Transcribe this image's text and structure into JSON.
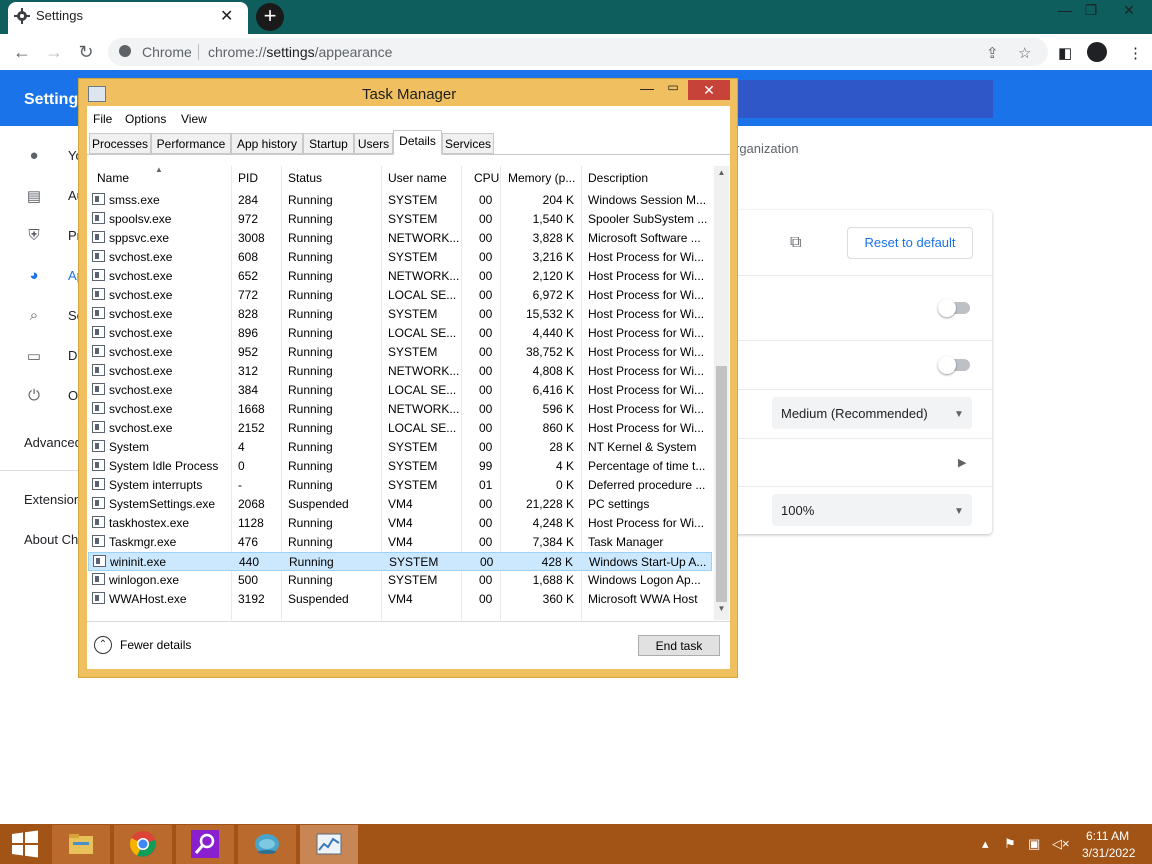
{
  "browser": {
    "tab_title": "Settings",
    "tab_close": "✕",
    "new_tab": "+",
    "window_controls": [
      "—",
      "❐",
      "✕"
    ],
    "omnibox_label": "Chrome",
    "url_scheme": "chrome://",
    "url_host": "settings",
    "url_path": "/appearance",
    "toolbar_icons": [
      "share-icon",
      "star-icon",
      "sidepanel-icon",
      "profile-icon",
      "menu-icon"
    ]
  },
  "settings": {
    "header_title": "Settings",
    "nav_items": [
      {
        "label": "Yo",
        "icon": "person-icon"
      },
      {
        "label": "Au",
        "icon": "autofill-icon"
      },
      {
        "label": "Pr",
        "icon": "shield-icon"
      },
      {
        "label": "Ap",
        "icon": "palette-icon"
      },
      {
        "label": "Se",
        "icon": "search-icon"
      },
      {
        "label": "De",
        "icon": "browser-icon"
      },
      {
        "label": "Or",
        "icon": "power-icon"
      }
    ],
    "advanced": "Advanced",
    "extensions": "Extension",
    "about": "About Ch",
    "org_note": "rganization",
    "reset_button": "Reset to default",
    "font_size_value": "Medium (Recommended)",
    "zoom_value": "100%",
    "accent_color": "#1a73e8"
  },
  "task_manager": {
    "title": "Task Manager",
    "menu": [
      "File",
      "Options",
      "View"
    ],
    "tabs": [
      "Processes",
      "Performance",
      "App history",
      "Startup",
      "Users",
      "Details",
      "Services"
    ],
    "active_tab": "Details",
    "columns": [
      "Name",
      "PID",
      "Status",
      "User name",
      "CPU",
      "Memory (p...",
      "Description"
    ],
    "rows": [
      {
        "name": "smss.exe",
        "pid": "284",
        "status": "Running",
        "user": "SYSTEM",
        "cpu": "00",
        "mem": "204 K",
        "desc": "Windows Session M..."
      },
      {
        "name": "spoolsv.exe",
        "pid": "972",
        "status": "Running",
        "user": "SYSTEM",
        "cpu": "00",
        "mem": "1,540 K",
        "desc": "Spooler SubSystem ..."
      },
      {
        "name": "sppsvc.exe",
        "pid": "3008",
        "status": "Running",
        "user": "NETWORK...",
        "cpu": "00",
        "mem": "3,828 K",
        "desc": "Microsoft Software ..."
      },
      {
        "name": "svchost.exe",
        "pid": "608",
        "status": "Running",
        "user": "SYSTEM",
        "cpu": "00",
        "mem": "3,216 K",
        "desc": "Host Process for Wi..."
      },
      {
        "name": "svchost.exe",
        "pid": "652",
        "status": "Running",
        "user": "NETWORK...",
        "cpu": "00",
        "mem": "2,120 K",
        "desc": "Host Process for Wi..."
      },
      {
        "name": "svchost.exe",
        "pid": "772",
        "status": "Running",
        "user": "LOCAL SE...",
        "cpu": "00",
        "mem": "6,972 K",
        "desc": "Host Process for Wi..."
      },
      {
        "name": "svchost.exe",
        "pid": "828",
        "status": "Running",
        "user": "SYSTEM",
        "cpu": "00",
        "mem": "15,532 K",
        "desc": "Host Process for Wi..."
      },
      {
        "name": "svchost.exe",
        "pid": "896",
        "status": "Running",
        "user": "LOCAL SE...",
        "cpu": "00",
        "mem": "4,440 K",
        "desc": "Host Process for Wi..."
      },
      {
        "name": "svchost.exe",
        "pid": "952",
        "status": "Running",
        "user": "SYSTEM",
        "cpu": "00",
        "mem": "38,752 K",
        "desc": "Host Process for Wi..."
      },
      {
        "name": "svchost.exe",
        "pid": "312",
        "status": "Running",
        "user": "NETWORK...",
        "cpu": "00",
        "mem": "4,808 K",
        "desc": "Host Process for Wi..."
      },
      {
        "name": "svchost.exe",
        "pid": "384",
        "status": "Running",
        "user": "LOCAL SE...",
        "cpu": "00",
        "mem": "6,416 K",
        "desc": "Host Process for Wi..."
      },
      {
        "name": "svchost.exe",
        "pid": "1668",
        "status": "Running",
        "user": "NETWORK...",
        "cpu": "00",
        "mem": "596 K",
        "desc": "Host Process for Wi..."
      },
      {
        "name": "svchost.exe",
        "pid": "2152",
        "status": "Running",
        "user": "LOCAL SE...",
        "cpu": "00",
        "mem": "860 K",
        "desc": "Host Process for Wi..."
      },
      {
        "name": "System",
        "pid": "4",
        "status": "Running",
        "user": "SYSTEM",
        "cpu": "00",
        "mem": "28 K",
        "desc": "NT Kernel & System"
      },
      {
        "name": "System Idle Process",
        "pid": "0",
        "status": "Running",
        "user": "SYSTEM",
        "cpu": "99",
        "mem": "4 K",
        "desc": "Percentage of time t..."
      },
      {
        "name": "System interrupts",
        "pid": "-",
        "status": "Running",
        "user": "SYSTEM",
        "cpu": "01",
        "mem": "0 K",
        "desc": "Deferred procedure ..."
      },
      {
        "name": "SystemSettings.exe",
        "pid": "2068",
        "status": "Suspended",
        "user": "VM4",
        "cpu": "00",
        "mem": "21,228 K",
        "desc": "PC settings"
      },
      {
        "name": "taskhostex.exe",
        "pid": "1128",
        "status": "Running",
        "user": "VM4",
        "cpu": "00",
        "mem": "4,248 K",
        "desc": "Host Process for Wi..."
      },
      {
        "name": "Taskmgr.exe",
        "pid": "476",
        "status": "Running",
        "user": "VM4",
        "cpu": "00",
        "mem": "7,384 K",
        "desc": "Task Manager"
      },
      {
        "name": "wininit.exe",
        "pid": "440",
        "status": "Running",
        "user": "SYSTEM",
        "cpu": "00",
        "mem": "428 K",
        "desc": "Windows Start-Up A..."
      },
      {
        "name": "winlogon.exe",
        "pid": "500",
        "status": "Running",
        "user": "SYSTEM",
        "cpu": "00",
        "mem": "1,688 K",
        "desc": "Windows Logon Ap..."
      },
      {
        "name": "WWAHost.exe",
        "pid": "3192",
        "status": "Suspended",
        "user": "VM4",
        "cpu": "00",
        "mem": "360 K",
        "desc": "Microsoft WWA Host"
      }
    ],
    "selected_row": "wininit.exe",
    "fewer_details": "Fewer details",
    "end_task": "End task"
  },
  "taskbar": {
    "apps": [
      "file-explorer-icon",
      "chrome-icon",
      "search-app-icon",
      "globe-app-icon",
      "task-manager-icon"
    ],
    "time": "6:11 AM",
    "date": "3/31/2022"
  }
}
